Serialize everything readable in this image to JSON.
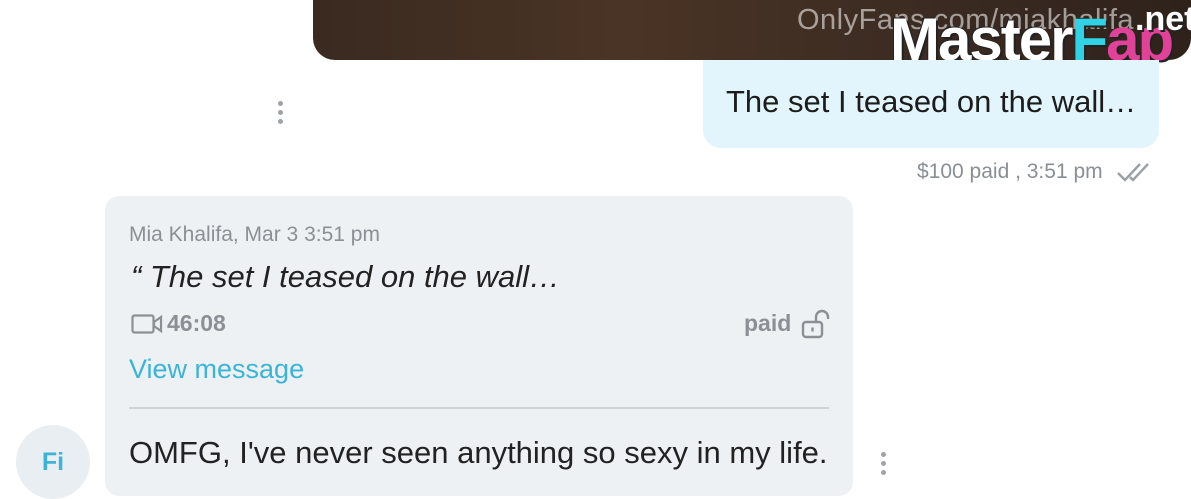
{
  "media": {
    "watermark": "OnlyFans.com/miakhalifa"
  },
  "logo": {
    "part1": "Master",
    "part2": "F",
    "part3": "ap",
    "suffix": ".net"
  },
  "outgoing": {
    "text": "The set I teased on the wall…",
    "status": "$100 paid , 3:51 pm",
    "status_icon": "double-check-icon"
  },
  "quoted": {
    "meta": "Mia Khalifa, Mar 3 3:51 pm",
    "text": "“ The set I teased on the wall…",
    "video_icon": "video-icon",
    "duration": "46:08",
    "paid_label": "paid",
    "lock_icon": "unlock-icon",
    "link": "View message"
  },
  "reply": {
    "text": "OMFG, I've never seen anything so sexy in my life."
  },
  "avatar": {
    "initials": "Fi"
  },
  "colors": {
    "accent": "#3bb4d8",
    "outgoing_bubble": "#e2f4fc",
    "incoming_bubble": "#eef1f3",
    "muted_text": "#8a9096"
  }
}
